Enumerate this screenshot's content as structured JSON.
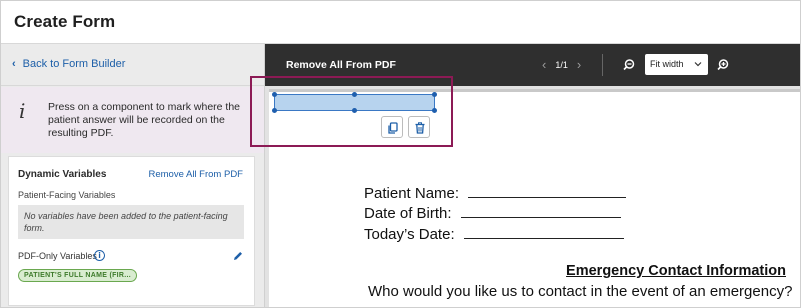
{
  "header": {
    "title": "Create Form"
  },
  "sidebar": {
    "back_label": "Back to Form Builder",
    "info_text": "Press on a component to mark where the patient answer will be recorded on the resulting PDF.",
    "card": {
      "title": "Dynamic Variables",
      "remove_label": "Remove All From PDF",
      "patient_facing_label": "Patient-Facing Variables",
      "empty_message": "No variables have been added to the patient-facing form.",
      "pdf_only_label": "PDF-Only Variables",
      "chip_label": "PATIENT'S FULL NAME (FIR..."
    }
  },
  "toolbar": {
    "remove_label": "Remove All From PDF",
    "page_indicator": "1/1",
    "zoom_value": "Fit width"
  },
  "pdf": {
    "patient_name": "Patient Name:",
    "date_of_birth": "Date of Birth:",
    "todays_date": "Today’s Date:",
    "emergency_title": "Emergency Contact Information",
    "emergency_question": "Who would you like us to contact in the event of an emergency?"
  },
  "icons": {
    "back": "chevron-left-icon",
    "info": "info-icon",
    "copy": "copy-icon",
    "delete": "trash-icon",
    "edit": "pencil-icon",
    "zoom_out": "zoom-out-icon",
    "zoom_in": "zoom-in-icon"
  },
  "colors": {
    "link": "#1d5fa8",
    "toolbar_bg": "#2f2f2f",
    "highlight_border": "#8c1a55",
    "selection_fill": "#b7d3ee",
    "chip_fill": "#d9ecd0"
  }
}
